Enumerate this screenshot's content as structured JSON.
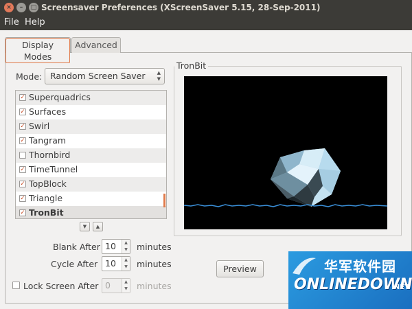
{
  "window": {
    "title": "Screensaver Preferences  (XScreenSaver 5.15, 28-Sep-2011)"
  },
  "menu": [
    "File",
    "Help"
  ],
  "tabs": [
    "Display Modes",
    "Advanced"
  ],
  "mode": {
    "label": "Mode:",
    "value": "Random Screen Saver"
  },
  "savers": [
    {
      "name": "Superquadrics",
      "checked": true
    },
    {
      "name": "Surfaces",
      "checked": true
    },
    {
      "name": "Swirl",
      "checked": true
    },
    {
      "name": "Tangram",
      "checked": true
    },
    {
      "name": "Thornbird",
      "checked": false
    },
    {
      "name": "TimeTunnel",
      "checked": true
    },
    {
      "name": "TopBlock",
      "checked": true
    },
    {
      "name": "Triangle",
      "checked": true
    },
    {
      "name": "TronBit",
      "checked": true,
      "selected": true
    }
  ],
  "settings": {
    "blank_after": {
      "label": "Blank After",
      "value": "10",
      "unit": "minutes"
    },
    "cycle_after": {
      "label": "Cycle After",
      "value": "10",
      "unit": "minutes"
    },
    "lock_after": {
      "label": "Lock Screen After",
      "value": "0",
      "unit": "minutes",
      "checked": false
    }
  },
  "preview": {
    "title": "TronBit",
    "button": "Preview"
  },
  "watermark": {
    "chinese": "华军软件园",
    "brand": "ONLINEDOWN",
    "suffix": ".NET"
  },
  "colors": {
    "accent": "#e07a4a",
    "titlebar": "#3c3b37",
    "window_bg": "#f2f1f0"
  }
}
